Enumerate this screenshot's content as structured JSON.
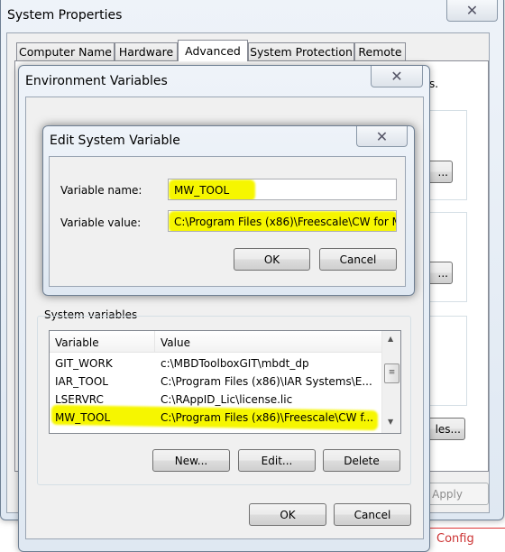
{
  "system_properties": {
    "title": "System Properties",
    "tabs": [
      {
        "label": "Computer Name"
      },
      {
        "label": "Hardware"
      },
      {
        "label": "Advanced",
        "selected": true
      },
      {
        "label": "System Protection"
      },
      {
        "label": "Remote"
      }
    ],
    "partial_text": "s.",
    "btn_partial_1": "...",
    "btn_partial_2": "...",
    "btn_partial_3": "les...",
    "apply_label": "Apply",
    "behind_text": "Config"
  },
  "env_vars": {
    "title": "Environment Variables",
    "system_vars_label": "System variables",
    "columns": [
      "Variable",
      "Value"
    ],
    "rows": [
      {
        "variable": "GIT_WORK",
        "value": "c:\\MBDToolboxGIT\\mbdt_dp"
      },
      {
        "variable": "IAR_TOOL",
        "value": "C:\\Program Files (x86)\\IAR Systems\\E..."
      },
      {
        "variable": "LSERVRC",
        "value": "C:\\RAppID_Lic\\license.lic"
      },
      {
        "variable": "MW_TOOL",
        "value": "C:\\Program Files (x86)\\Freescale\\CW f...",
        "highlighted": true
      }
    ],
    "new_label": "New...",
    "edit_label": "Edit...",
    "delete_label": "Delete",
    "ok_label": "OK",
    "cancel_label": "Cancel"
  },
  "edit_var": {
    "title": "Edit System Variable",
    "name_label": "Variable name:",
    "name_value": "MW_TOOL",
    "value_label": "Variable value:",
    "value_value": "C:\\Program Files (x86)\\Freescale\\CW for M",
    "ok_label": "OK",
    "cancel_label": "Cancel"
  },
  "colors": {
    "highlight": "#f6f600",
    "dialog_bg": "#f0f0f0"
  }
}
